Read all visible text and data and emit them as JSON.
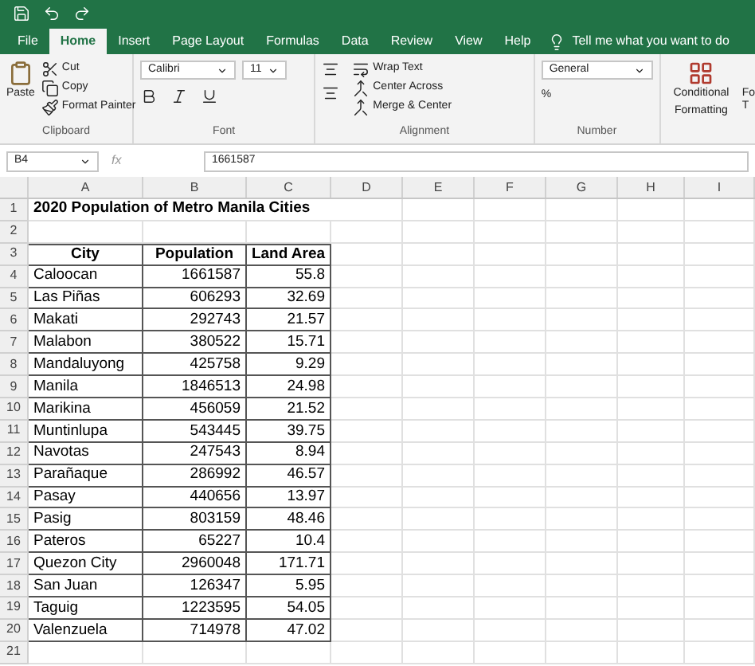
{
  "ribbon_tabs": [
    {
      "label": "File",
      "selected": false
    },
    {
      "label": "Home",
      "selected": true
    },
    {
      "label": "Insert",
      "selected": false
    },
    {
      "label": "Page Layout",
      "selected": false
    },
    {
      "label": "Formulas",
      "selected": false
    },
    {
      "label": "Data",
      "selected": false
    },
    {
      "label": "Review",
      "selected": false
    },
    {
      "label": "View",
      "selected": false
    },
    {
      "label": "Help",
      "selected": false
    }
  ],
  "tell_me": "Tell me what you want to do",
  "clipboard": {
    "paste": "Paste",
    "cut": "Cut",
    "copy": "Copy",
    "format_painter": "Format Painter",
    "group": "Clipboard"
  },
  "font": {
    "name": "Calibri",
    "size": "11",
    "group": "Font"
  },
  "alignment": {
    "wrap": "Wrap Text",
    "center_across": "Center Across",
    "merge": "Merge & Center",
    "group": "Alignment"
  },
  "number": {
    "format": "General",
    "percent": "%",
    "group": "Number"
  },
  "styles": {
    "conditional": "Conditional",
    "formatting": "Formatting",
    "cut_top": "Fo",
    "cut_bottom": "T"
  },
  "fx_label": "fx",
  "row_numbers": [
    "1",
    "2",
    "3",
    "4",
    "5",
    "6",
    "7",
    "8",
    "9",
    "10",
    "11",
    "12",
    "13",
    "14",
    "15",
    "16",
    "17",
    "18",
    "19",
    "20",
    "21"
  ],
  "name_box": "B4",
  "formula": "1661587",
  "columns": [
    "A",
    "B",
    "C",
    "D",
    "E",
    "F",
    "G",
    "H",
    "I"
  ],
  "title": "2020 Population of Metro Manila Cities",
  "headers": [
    "City",
    "Population",
    "Land Area"
  ],
  "rows": [
    [
      "Caloocan",
      "1661587",
      "55.8"
    ],
    [
      "Las Piñas",
      "606293",
      "32.69"
    ],
    [
      "Makati",
      "292743",
      "21.57"
    ],
    [
      "Malabon",
      "380522",
      "15.71"
    ],
    [
      "Mandaluyong",
      "425758",
      "9.29"
    ],
    [
      "Manila",
      "1846513",
      "24.98"
    ],
    [
      "Marikina",
      "456059",
      "21.52"
    ],
    [
      "Muntinlupa",
      "543445",
      "39.75"
    ],
    [
      "Navotas",
      "247543",
      "8.94"
    ],
    [
      "Parañaque",
      "286992",
      "46.57"
    ],
    [
      "Pasay",
      "440656",
      "13.97"
    ],
    [
      "Pasig",
      "803159",
      "48.46"
    ],
    [
      "Pateros",
      "65227",
      "10.4"
    ],
    [
      "Quezon City",
      "2960048",
      "171.71"
    ],
    [
      "San Juan",
      "126347",
      "5.95"
    ],
    [
      "Taguig",
      "1223595",
      "54.05"
    ],
    [
      "Valenzuela",
      "714978",
      "47.02"
    ]
  ]
}
